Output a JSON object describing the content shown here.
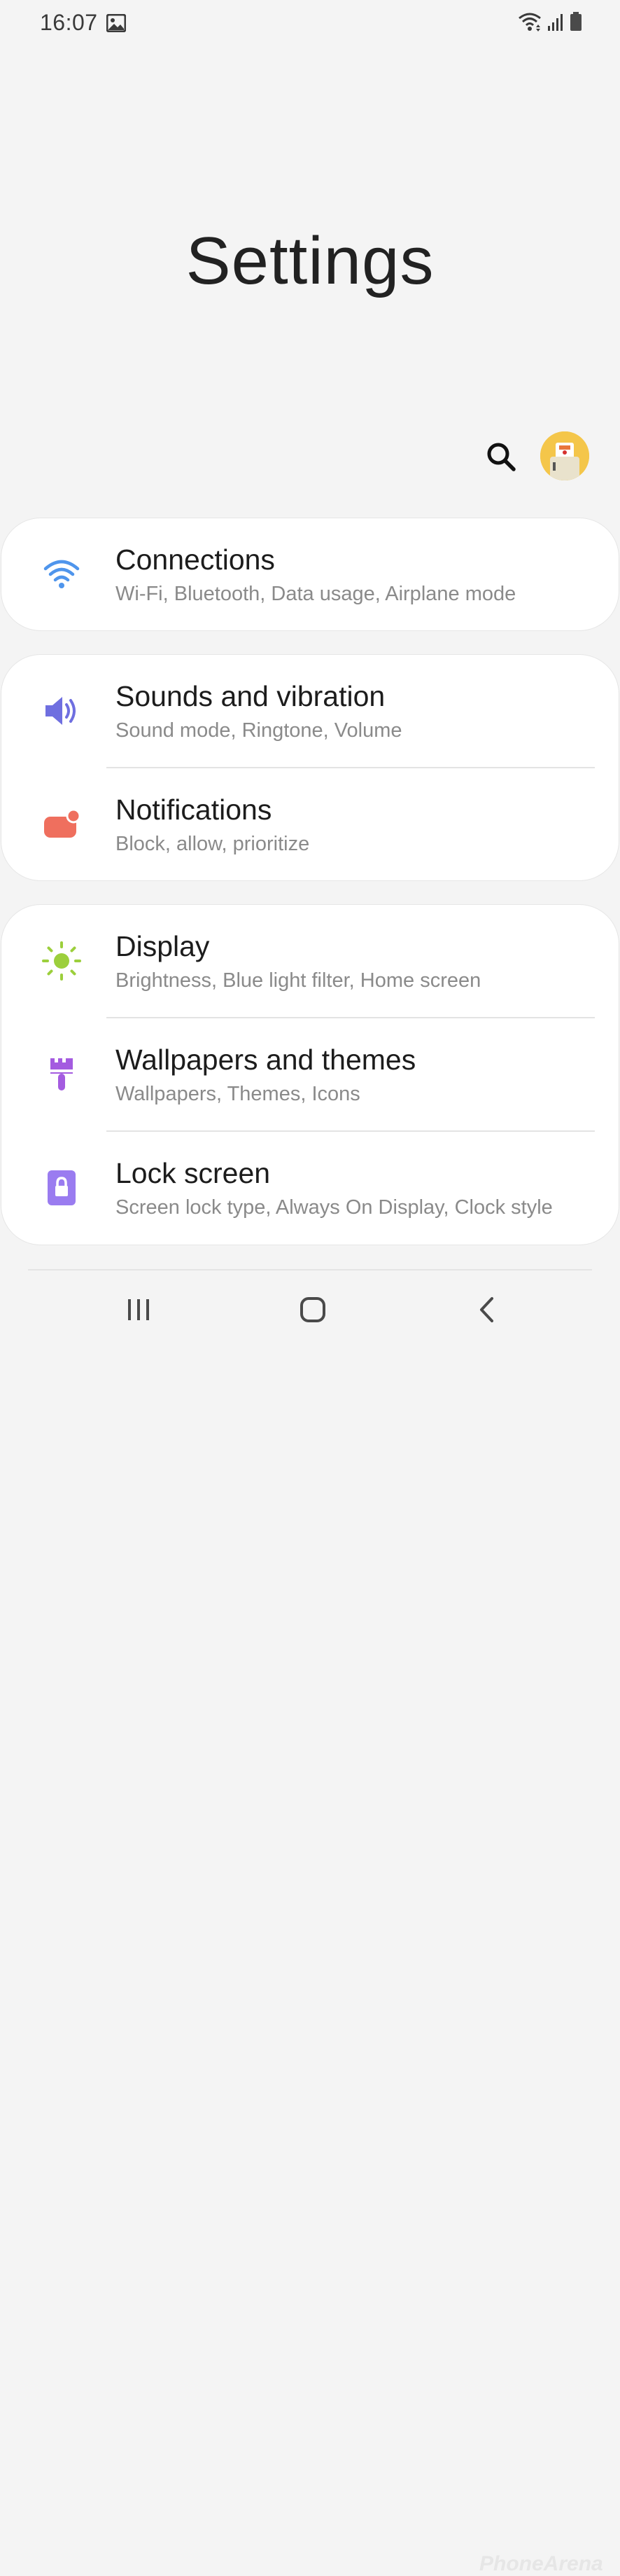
{
  "status_bar": {
    "time": "16:07",
    "icons": [
      "gallery-icon",
      "wifi-icon",
      "signal-icon",
      "battery-icon"
    ]
  },
  "header": {
    "title": "Settings"
  },
  "toolbar": {
    "search_icon": "search-icon",
    "profile_icon": "profile-avatar"
  },
  "settings": [
    {
      "group": 1,
      "items": [
        {
          "icon": "wifi-icon",
          "color": "#4f95ec",
          "title": "Connections",
          "subtitle": "Wi-Fi, Bluetooth, Data usage, Airplane mode"
        }
      ]
    },
    {
      "group": 2,
      "items": [
        {
          "icon": "speaker-icon",
          "color": "#6f6fe0",
          "title": "Sounds and vibration",
          "subtitle": "Sound mode, Ringtone, Volume"
        },
        {
          "icon": "notification-icon",
          "color": "#ef6f5e",
          "title": "Notifications",
          "subtitle": "Block, allow, prioritize"
        }
      ]
    },
    {
      "group": 3,
      "items": [
        {
          "icon": "sun-icon",
          "color": "#9ccf3c",
          "title": "Display",
          "subtitle": "Brightness, Blue light filter, Home screen"
        },
        {
          "icon": "paintbrush-icon",
          "color": "#a45be0",
          "title": "Wallpapers and themes",
          "subtitle": "Wallpapers, Themes, Icons"
        },
        {
          "icon": "lock-icon",
          "color": "#9a7cf0",
          "title": "Lock screen",
          "subtitle": "Screen lock type, Always On Display, Clock style"
        }
      ]
    }
  ],
  "nav_bar": {
    "buttons": [
      "recent-apps-icon",
      "home-icon",
      "back-icon"
    ]
  },
  "watermark": "PhoneArena"
}
